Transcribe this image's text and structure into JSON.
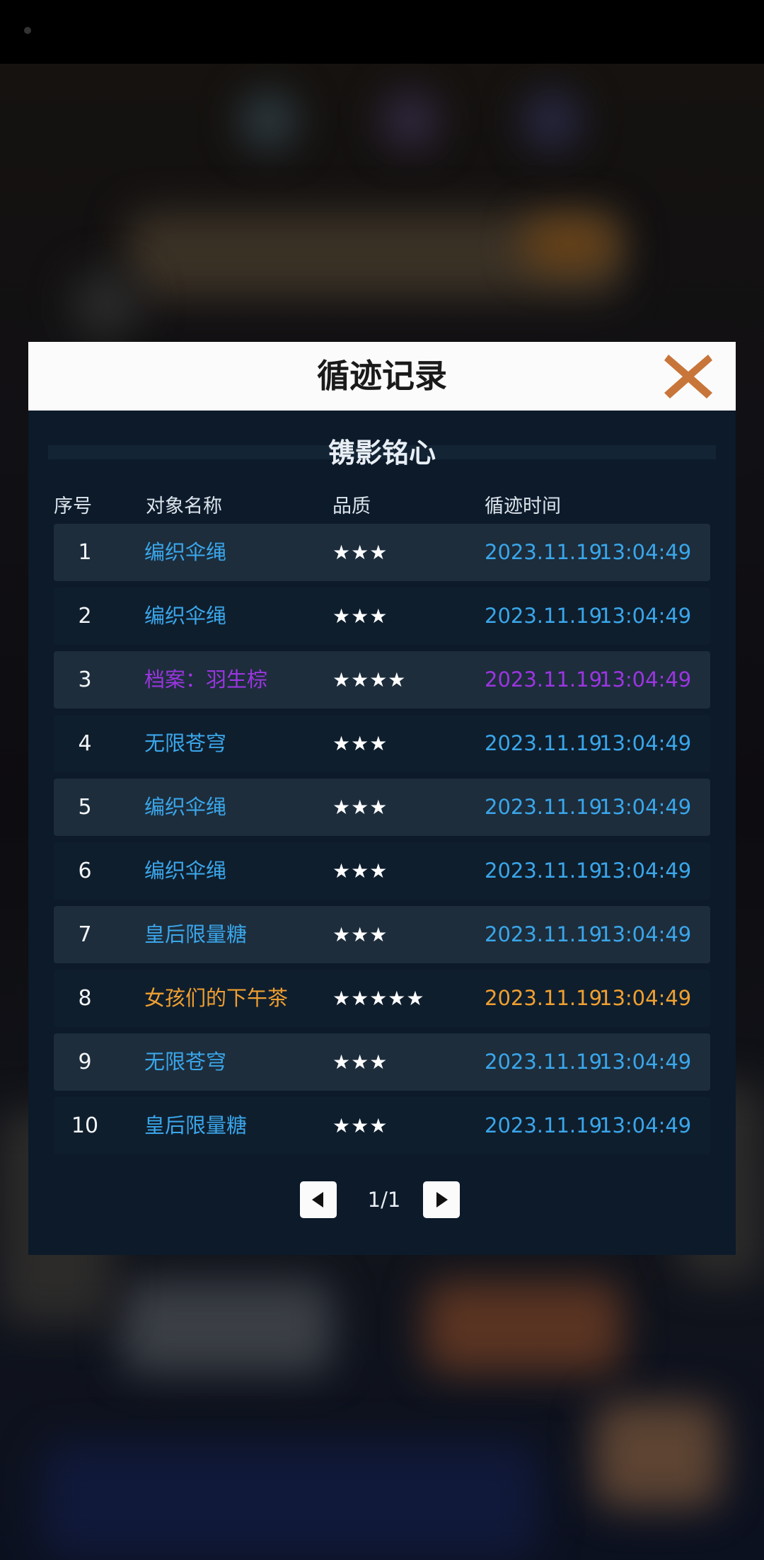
{
  "dialog": {
    "title": "循迹记录",
    "subtitle": "镌影铭心",
    "columns": {
      "seq": "序号",
      "name": "对象名称",
      "quality": "品质",
      "time": "循迹时间"
    },
    "rows": [
      {
        "seq": "1",
        "name": "编织伞绳",
        "stars": "★★★",
        "date": "2023.11.19",
        "time": "13:04:49",
        "color": "#3aa6ea"
      },
      {
        "seq": "2",
        "name": "编织伞绳",
        "stars": "★★★",
        "date": "2023.11.19",
        "time": "13:04:49",
        "color": "#3aa6ea"
      },
      {
        "seq": "3",
        "name": "档案：羽生棕",
        "stars": "★★★★",
        "date": "2023.11.19",
        "time": "13:04:49",
        "color": "#9b35e0"
      },
      {
        "seq": "4",
        "name": "无限苍穹",
        "stars": "★★★",
        "date": "2023.11.19",
        "time": "13:04:49",
        "color": "#3aa6ea"
      },
      {
        "seq": "5",
        "name": "编织伞绳",
        "stars": "★★★",
        "date": "2023.11.19",
        "time": "13:04:49",
        "color": "#3aa6ea"
      },
      {
        "seq": "6",
        "name": "编织伞绳",
        "stars": "★★★",
        "date": "2023.11.19",
        "time": "13:04:49",
        "color": "#3aa6ea"
      },
      {
        "seq": "7",
        "name": "皇后限量糖",
        "stars": "★★★",
        "date": "2023.11.19",
        "time": "13:04:49",
        "color": "#3aa6ea"
      },
      {
        "seq": "8",
        "name": "女孩们的下午茶",
        "stars": "★★★★★",
        "date": "2023.11.19",
        "time": "13:04:49",
        "color": "#f0a030"
      },
      {
        "seq": "9",
        "name": "无限苍穹",
        "stars": "★★★",
        "date": "2023.11.19",
        "time": "13:04:49",
        "color": "#3aa6ea"
      },
      {
        "seq": "10",
        "name": "皇后限量糖",
        "stars": "★★★",
        "date": "2023.11.19",
        "time": "13:04:49",
        "color": "#3aa6ea"
      }
    ],
    "pager": {
      "text": "1/1",
      "prev_icon": "triangle-left-icon",
      "next_icon": "triangle-right-icon"
    },
    "close_icon": "close-x-icon",
    "close_color": "#c8753a"
  }
}
